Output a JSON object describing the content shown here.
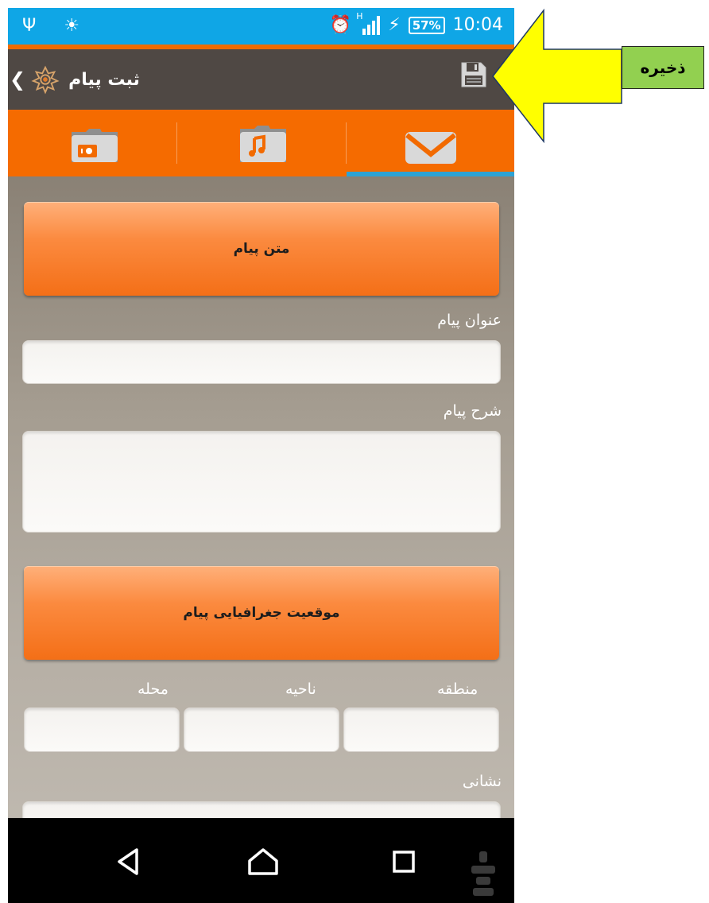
{
  "status_bar": {
    "battery": "57%",
    "network_type": "H",
    "time": "10:04",
    "left_icons": [
      "usb-icon",
      "android-debug-icon"
    ],
    "right_icons": [
      "alarm-icon",
      "signal-icon",
      "charging-icon",
      "battery-icon"
    ]
  },
  "action_bar": {
    "title": "ثبت پیام",
    "icons": [
      "back-chevron-icon",
      "app-logo-icon",
      "save-icon"
    ]
  },
  "tabs": [
    {
      "icon": "camera-folder-icon",
      "selected": false
    },
    {
      "icon": "music-folder-icon",
      "selected": false
    },
    {
      "icon": "envelope-icon",
      "selected": true
    }
  ],
  "form": {
    "message_text_button": "متن پیام",
    "title_label": "عنوان پیام",
    "title_value": "",
    "description_label": "شرح پیام",
    "description_value": "",
    "geo_location_button": "موقعیت جغرافیایی پیام",
    "region_label": "منطقه",
    "district_label": "ناحیه",
    "neighborhood_label": "محله",
    "region_value": "",
    "district_value": "",
    "neighborhood_value": "",
    "address_label": "نشانی",
    "address_value": ""
  },
  "nav_bar": {
    "icons": [
      "back-triangle-icon",
      "home-icon",
      "recents-icon"
    ]
  },
  "annotation": {
    "label": "ذخیره"
  },
  "colors": {
    "status_bar": "#0fa6e6",
    "action_bar": "#4f4844",
    "tab_bar": "#f56b00",
    "tab_indicator": "#2ea3d5",
    "button_orange": "#f46f17",
    "annotation_arrow": "#ffff00",
    "annotation_box": "#92d050"
  }
}
